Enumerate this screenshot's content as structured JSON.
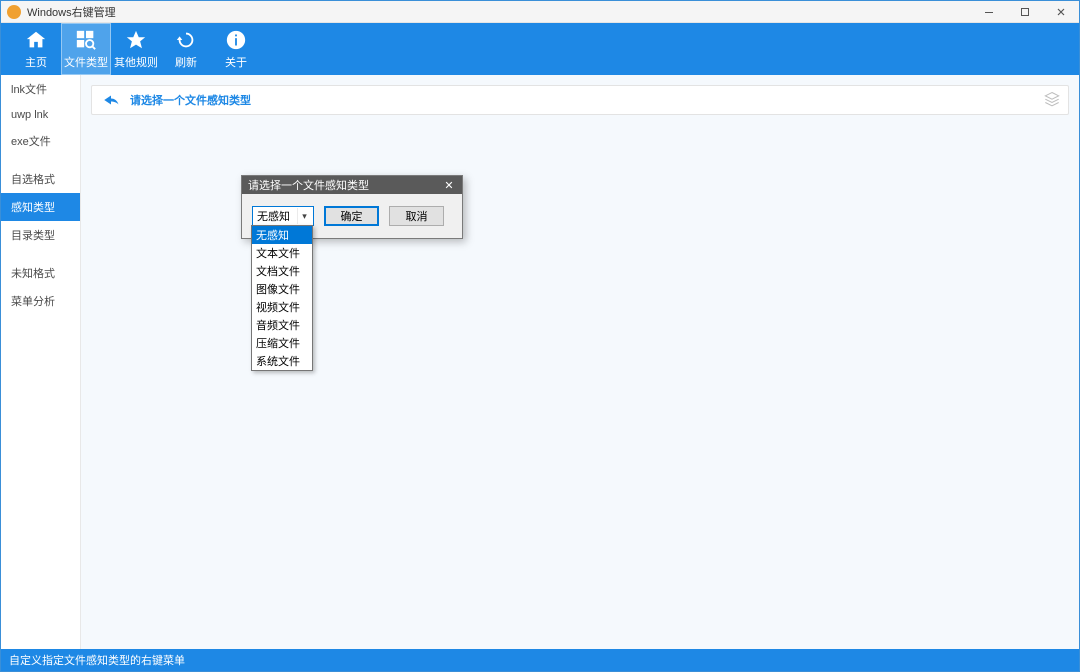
{
  "window": {
    "title": "Windows右键管理"
  },
  "toolbar": {
    "items": [
      {
        "key": "home",
        "label": "主页",
        "active": false
      },
      {
        "key": "filetype",
        "label": "文件类型",
        "active": true
      },
      {
        "key": "rules",
        "label": "其他规则",
        "active": false
      },
      {
        "key": "refresh",
        "label": "刷新",
        "active": false
      },
      {
        "key": "about",
        "label": "关于",
        "active": false
      }
    ]
  },
  "sidebar": {
    "groups": [
      [
        "lnk文件",
        "uwp lnk",
        "exe文件"
      ],
      [
        "自选格式",
        "感知类型",
        "目录类型"
      ],
      [
        "未知格式",
        "菜单分析"
      ]
    ],
    "selected": "感知类型"
  },
  "main": {
    "hint": "请选择一个文件感知类型"
  },
  "dialog": {
    "title": "请选择一个文件感知类型",
    "selected": "无感知",
    "options": [
      "无感知",
      "文本文件",
      "文档文件",
      "图像文件",
      "视频文件",
      "音频文件",
      "压缩文件",
      "系统文件"
    ],
    "ok": "确定",
    "cancel": "取消"
  },
  "footer": {
    "text": "自定义指定文件感知类型的右键菜单"
  },
  "colors": {
    "primary": "#1e88e5",
    "primary_light": "#4fa3eb",
    "select_blue": "#0078d7"
  }
}
